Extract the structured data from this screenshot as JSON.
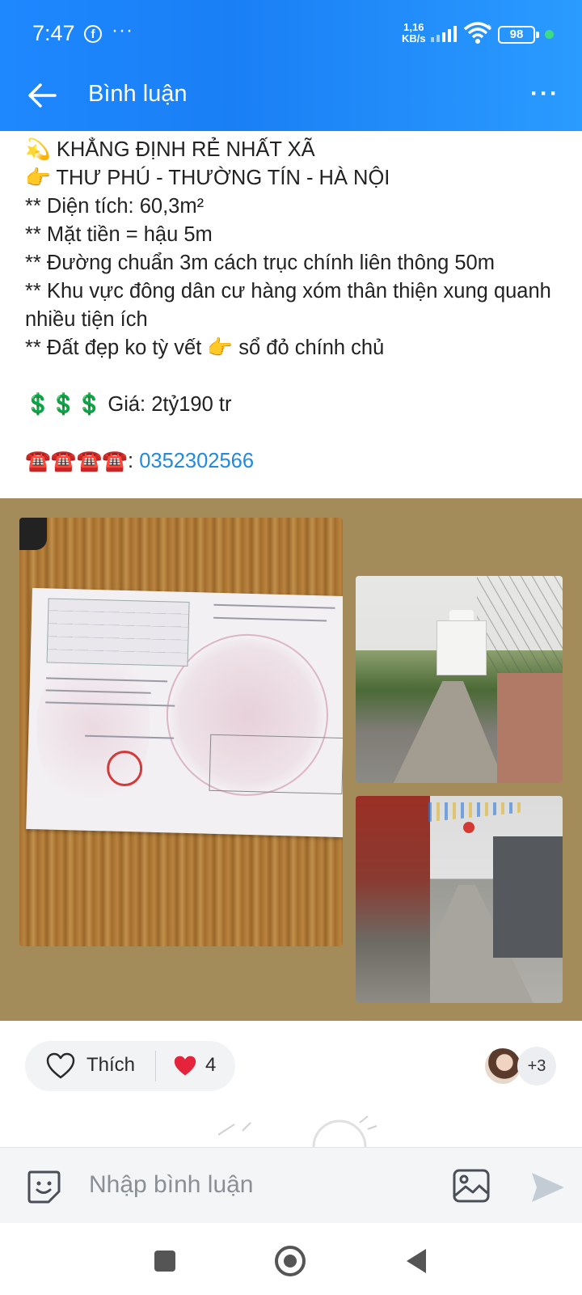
{
  "status_bar": {
    "time": "7:47",
    "notification_icon": "facebook-icon",
    "more_notifications": "···",
    "net_speed_value": "1,16",
    "net_speed_unit": "KB/s",
    "battery": "98"
  },
  "app_bar": {
    "title": "Bình luận",
    "back_icon": "arrow-left-icon",
    "menu_icon": "more-horizontal-icon",
    "background_color": "#1e88ff"
  },
  "post": {
    "line1_emoji": "💫",
    "line1": "KHẲNG ĐỊNH RẺ NHẤT XÃ",
    "line2_emoji": "👉",
    "line2": "THƯ PHÚ - THƯỜNG TÍN - HÀ NỘI",
    "line3": "** Diện tích: 60,3m²",
    "line4": "** Mặt tiền = hậu 5m",
    "line5": "** Đường chuẩn 3m cách trục chính liên thông 50m",
    "line6": "** Khu vực đông dân cư hàng xóm thân thiện xung quanh nhiều tiện ích",
    "line7_prefix": "** Đất đẹp ko tỳ vết",
    "line7_emoji": "👉",
    "line7_suffix": "sổ đỏ chính chủ",
    "price_emoji": "💲💲💲",
    "price": "Giá: 2tỷ190 tr",
    "phone_emoji": "☎️☎️☎️☎️",
    "phone_separator": ":",
    "phone": "0352302566",
    "phone_color": "#1f8ae0"
  },
  "media": {
    "background_color": "#a48c5a",
    "images": [
      {
        "name": "land-certificate-photo"
      },
      {
        "name": "house-and-road-photo"
      },
      {
        "name": "alley-photo"
      }
    ]
  },
  "reactions": {
    "like_icon": "heart-outline-icon",
    "like_label": "Thích",
    "reaction_icon": "heart-filled-icon",
    "reaction_color": "#e5243b",
    "count": "4",
    "more_reactors": "+3"
  },
  "comment_bar": {
    "sticker_icon": "sticker-smile-icon",
    "placeholder": "Nhập bình luận",
    "image_icon": "image-icon",
    "send_icon": "send-icon"
  },
  "nav_bar": {
    "recent_icon": "square-icon",
    "home_icon": "circle-home-icon",
    "back_icon": "triangle-back-icon"
  }
}
